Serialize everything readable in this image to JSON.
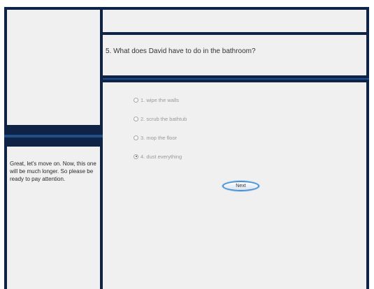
{
  "sidebar": {
    "message": "Great, let's move on. Now, this one will be much longer. So please be ready to pay attention."
  },
  "question": {
    "text": "5. What does David have to do in the bathroom?"
  },
  "options": [
    {
      "label": "1. wipe the walls",
      "selected": false
    },
    {
      "label": "2. scrub the bathtub",
      "selected": false
    },
    {
      "label": "3. mop the floor",
      "selected": false
    },
    {
      "label": "4. dust everything",
      "selected": true
    }
  ],
  "buttons": {
    "next_label": "Next"
  },
  "colors": {
    "frame": "#0e2346",
    "panel": "#f0f0f0",
    "accent": "#4b90cf"
  }
}
